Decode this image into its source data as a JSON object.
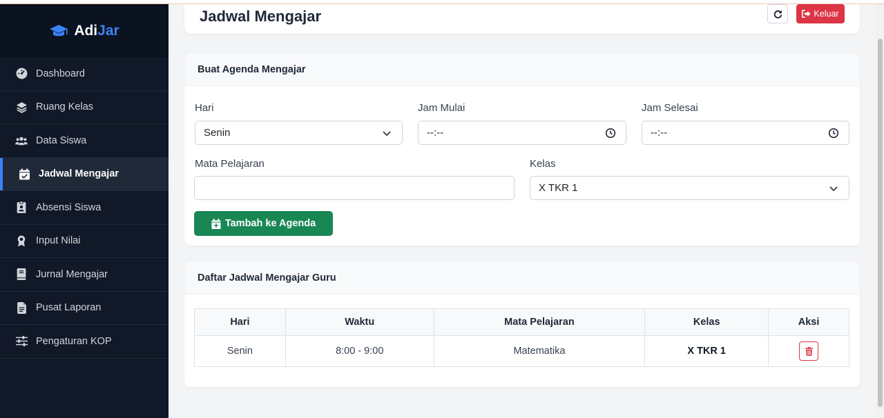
{
  "brand": {
    "part1": "Adi",
    "part2": "Jar",
    "icon": "graduation-cap-icon"
  },
  "sidebar": {
    "items": [
      {
        "label": "Dashboard",
        "icon": "dashboard-icon"
      },
      {
        "label": "Ruang Kelas",
        "icon": "layers-icon"
      },
      {
        "label": "Data Siswa",
        "icon": "users-icon"
      },
      {
        "label": "Jadwal Mengajar",
        "icon": "calendar-check-icon",
        "active": true
      },
      {
        "label": "Absensi Siswa",
        "icon": "id-badge-icon"
      },
      {
        "label": "Input Nilai",
        "icon": "award-icon"
      },
      {
        "label": "Jurnal Mengajar",
        "icon": "book-icon"
      },
      {
        "label": "Pusat Laporan",
        "icon": "file-icon"
      },
      {
        "label": "Pengaturan KOP",
        "icon": "sliders-icon"
      }
    ]
  },
  "header": {
    "title": "Jadwal Mengajar",
    "logout_label": "Keluar"
  },
  "form": {
    "title": "Buat Agenda Mengajar",
    "hari_label": "Hari",
    "hari_value": "Senin",
    "jam_mulai_label": "Jam Mulai",
    "jam_mulai_value": "--:--",
    "jam_selesai_label": "Jam Selesai",
    "jam_selesai_value": "--:--",
    "mapel_label": "Mata Pelajaran",
    "mapel_value": "",
    "kelas_label": "Kelas",
    "kelas_value": "X TKR 1",
    "submit_label": "Tambah ke Agenda"
  },
  "schedule": {
    "title": "Daftar Jadwal Mengajar Guru",
    "columns": [
      "Hari",
      "Waktu",
      "Mata Pelajaran",
      "Kelas",
      "Aksi"
    ],
    "rows": [
      {
        "hari": "Senin",
        "waktu": "8:00 - 9:00",
        "mapel": "Matematika",
        "kelas": "X TKR 1"
      }
    ]
  },
  "colors": {
    "sidebar_bg": "#111827",
    "accent": "#3b82f6",
    "success": "#198754",
    "danger": "#dc3545"
  }
}
